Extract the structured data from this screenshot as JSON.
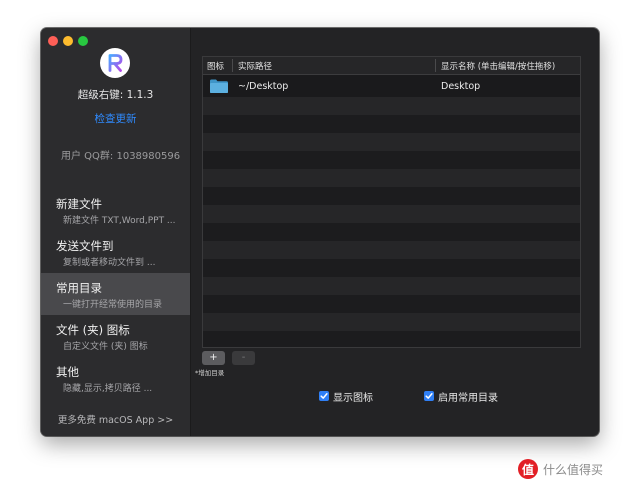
{
  "app": {
    "name_version": "超级右键: 1.1.3",
    "check_update": "检查更新",
    "qq_group": "用户 QQ群: 1038980596",
    "more_apps": "更多免费 macOS App >>",
    "accent_color": "#2f8bff"
  },
  "sidebar": {
    "items": [
      {
        "title": "新建文件",
        "subtitle": "新建文件 TXT,Word,PPT ..."
      },
      {
        "title": "发送文件到",
        "subtitle": "复制或者移动文件到 ..."
      },
      {
        "title": "常用目录",
        "subtitle": "一键打开经常使用的目录",
        "active": true
      },
      {
        "title": "文件 (夹) 图标",
        "subtitle": "自定义文件 (夹) 图标"
      },
      {
        "title": "其他",
        "subtitle": "隐藏,显示,拷贝路径 ..."
      }
    ]
  },
  "table": {
    "columns": [
      "图标",
      "实际路径",
      "显示名称 (单击编辑/按住拖移)"
    ],
    "rows": [
      {
        "icon": "folder-icon",
        "path": "~/Desktop",
        "display_name": "Desktop"
      }
    ]
  },
  "controls": {
    "add_label": "+",
    "remove_label": "-",
    "add_caption": "*增加目录",
    "show_icon_label": "显示图标",
    "show_icon_checked": true,
    "enable_dirs_label": "启用常用目录",
    "enable_dirs_checked": true
  },
  "watermark": {
    "logo_text": "值",
    "text": "什么值得买"
  }
}
